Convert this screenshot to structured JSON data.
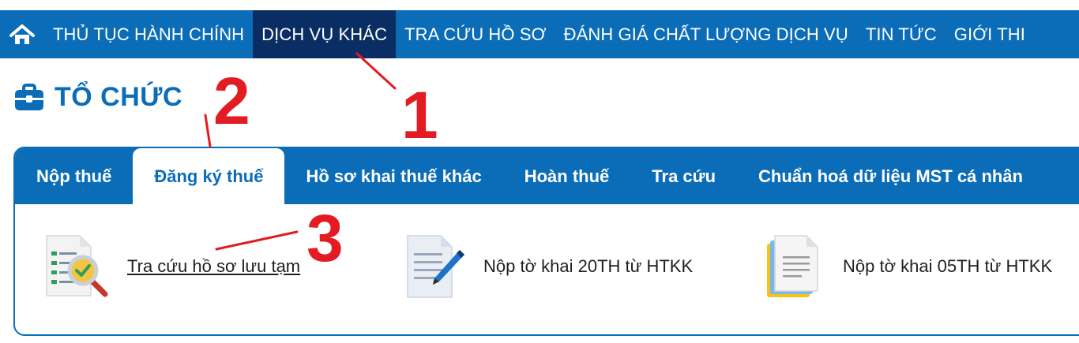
{
  "nav": {
    "home_icon": "home-icon",
    "items": [
      {
        "label": "THỦ TỤC HÀNH CHÍNH",
        "active": false
      },
      {
        "label": "DỊCH VỤ KHÁC",
        "active": true
      },
      {
        "label": "TRA CỨU HỒ SƠ",
        "active": false
      },
      {
        "label": "ĐÁNH GIÁ CHẤT LƯỢNG DỊCH VỤ",
        "active": false
      },
      {
        "label": "TIN TỨC",
        "active": false
      },
      {
        "label": "GIỚI THI",
        "active": false
      }
    ]
  },
  "heading": {
    "icon": "briefcase-icon",
    "title": "TỔ CHỨC"
  },
  "tabs": [
    {
      "label": "Nộp thuế",
      "active": false
    },
    {
      "label": "Đăng ký thuế",
      "active": true
    },
    {
      "label": "Hồ sơ khai thuế khác",
      "active": false
    },
    {
      "label": "Hoàn thuế",
      "active": false
    },
    {
      "label": "Tra cứu",
      "active": false
    },
    {
      "label": "Chuẩn hoá dữ liệu MST cá nhân",
      "active": false
    }
  ],
  "services": [
    {
      "label": "Tra cứu hồ sơ lưu tạm",
      "icon": "document-search-icon",
      "link": true
    },
    {
      "label": "Nộp tờ khai 20TH từ HTKK",
      "icon": "document-pen-icon",
      "link": false
    },
    {
      "label": "Nộp tờ khai 05TH từ HTKK",
      "icon": "document-stack-icon",
      "link": false
    }
  ],
  "annotations": {
    "step1": "1",
    "step2": "2",
    "step3": "3"
  },
  "colors": {
    "primary": "#0b6db7",
    "nav_active": "#0a2e63",
    "annotation": "#e31b23"
  }
}
